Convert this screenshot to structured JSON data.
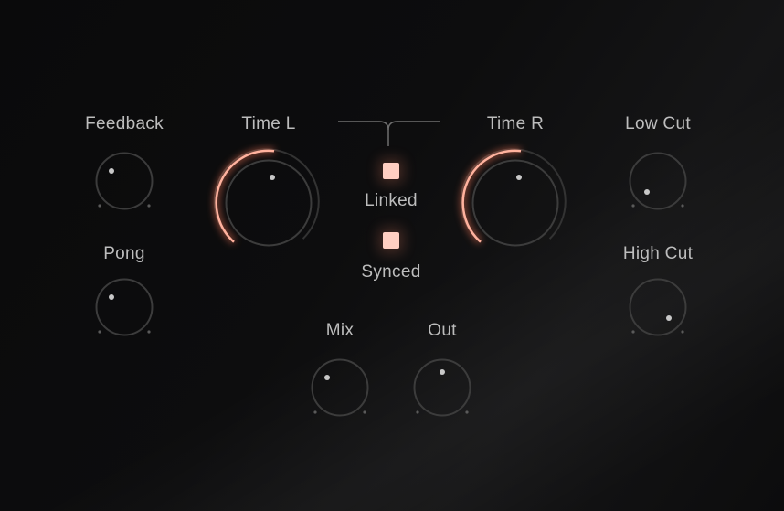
{
  "colors": {
    "accent": "#ff9f86",
    "accent_glow": "#ff7a5a",
    "toggle_fill": "#ffcfc2",
    "ring": "#3c3c3c",
    "label": "#bdbdbd",
    "pointer": "#c8c8c8"
  },
  "controls": {
    "feedback": {
      "label": "Feedback"
    },
    "pong": {
      "label": "Pong"
    },
    "time_l": {
      "label": "Time L"
    },
    "time_r": {
      "label": "Time R"
    },
    "low_cut": {
      "label": "Low Cut"
    },
    "high_cut": {
      "label": "High Cut"
    },
    "mix": {
      "label": "Mix"
    },
    "out": {
      "label": "Out"
    }
  },
  "toggles": {
    "linked": {
      "label": "Linked",
      "on": true
    },
    "synced": {
      "label": "Synced",
      "on": true
    }
  }
}
